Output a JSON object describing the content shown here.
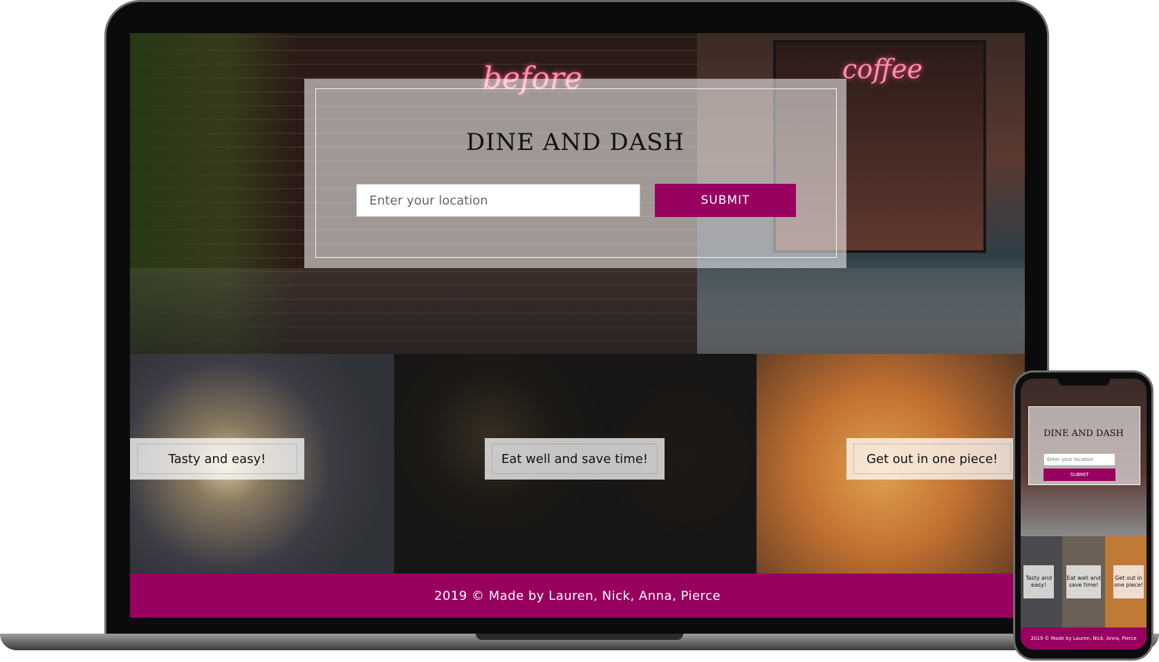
{
  "site": {
    "title": "DINE AND DASH",
    "search_placeholder": "Enter your location",
    "submit_label": "SUBMIT",
    "captions": [
      "Tasty and easy!",
      "Eat well and save time!",
      "Get out in one piece!"
    ],
    "footer": "2019 © Made by Lauren, Nick, Anna, Pierce",
    "accent_color": "#980060"
  },
  "mobile": {
    "title": "DINE AND DASH",
    "search_placeholder": "Enter your location",
    "submit_label": "SUBMIT",
    "captions": [
      "Tasty and easy!",
      "Eat well and save time!",
      "Get out in one piece!"
    ],
    "footer": "2019 © Made by Lauren, Nick, Anna, Pierce"
  },
  "decor": {
    "neon_sign_left": "before",
    "neon_sign_right": "coffee"
  }
}
